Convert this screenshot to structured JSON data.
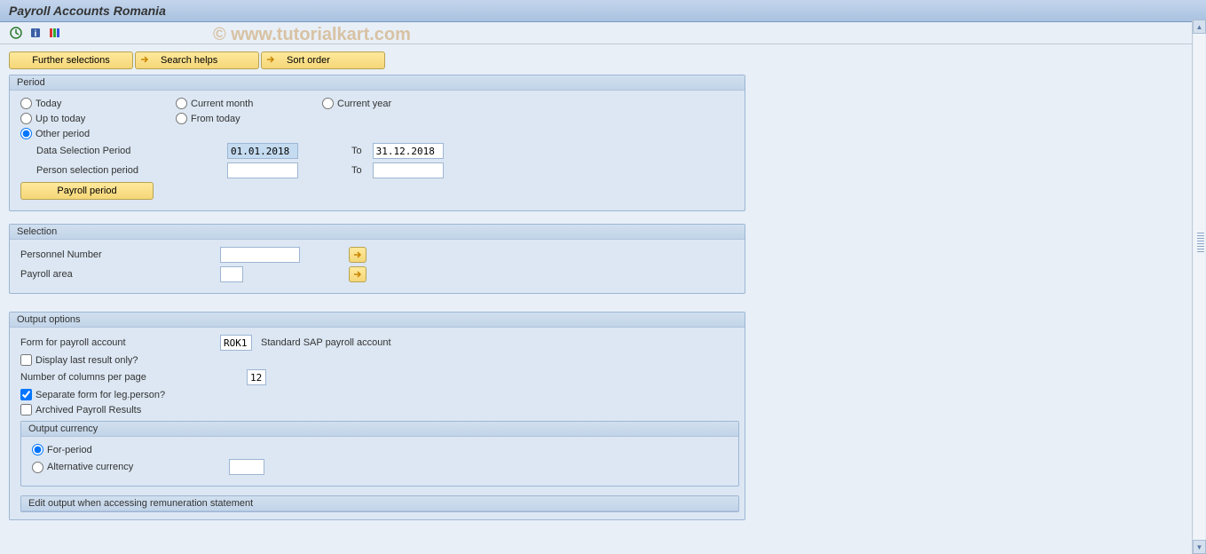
{
  "title": "Payroll Accounts Romania",
  "watermark": "© www.tutorialkart.com",
  "selButtons": {
    "further": "Further selections",
    "search": "Search helps",
    "sort": "Sort order"
  },
  "period": {
    "header": "Period",
    "today": "Today",
    "currentMonth": "Current month",
    "currentYear": "Current year",
    "upToToday": "Up to today",
    "fromToday": "From today",
    "otherPeriod": "Other period",
    "dataSelPeriod": "Data Selection Period",
    "dataSelFrom": "01.01.2018",
    "to": "To",
    "dataSelTo": "31.12.2018",
    "personSelPeriod": "Person selection period",
    "personSelFrom": "",
    "personSelTo": "",
    "payrollPeriodBtn": "Payroll period"
  },
  "selection": {
    "header": "Selection",
    "personnelNumber": "Personnel Number",
    "payrollArea": "Payroll area"
  },
  "output": {
    "header": "Output options",
    "formLabel": "Form for payroll account",
    "formValue": "ROK1",
    "formDesc": "Standard SAP payroll account",
    "displayLast": "Display last result only?",
    "numCols": "Number of columns per page",
    "numColsValue": "12",
    "separateForm": "Separate form for leg.person?",
    "archived": "Archived Payroll Results",
    "currencyHeader": "Output currency",
    "forPeriod": "For-period",
    "altCurrency": "Alternative currency",
    "editOutputHeader": "Edit output when accessing remuneration statement"
  },
  "icons": {
    "execute": "execute",
    "info": "info",
    "color": "color"
  }
}
